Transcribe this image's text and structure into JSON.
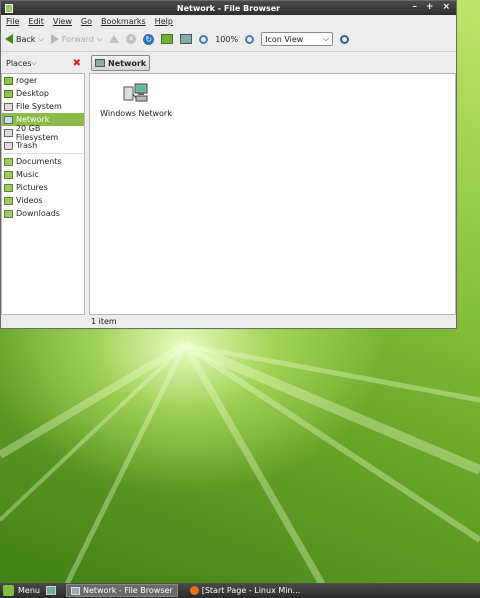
{
  "window": {
    "title": "Network - File Browser",
    "controls": [
      "–",
      "+",
      "×"
    ]
  },
  "menubar": [
    "File",
    "Edit",
    "View",
    "Go",
    "Bookmarks",
    "Help"
  ],
  "toolbar": {
    "back_label": "Back",
    "forward_label": "Forward",
    "zoom_level": "100%",
    "view_mode": "Icon View",
    "view_caret": "⌵"
  },
  "pathbar": {
    "places_label": "Places",
    "current": "Network"
  },
  "sidebar": {
    "items": [
      {
        "label": "roger",
        "icon": "home-folder-icon"
      },
      {
        "label": "Desktop",
        "icon": "desktop-icon"
      },
      {
        "label": "File System",
        "icon": "drive-icon"
      },
      {
        "label": "Network",
        "icon": "network-icon",
        "selected": true
      },
      {
        "label": "20 GB Filesystem",
        "icon": "drive-icon"
      },
      {
        "label": "Trash",
        "icon": "trash-icon"
      },
      {
        "label": "Documents",
        "icon": "folder-icon"
      },
      {
        "label": "Music",
        "icon": "folder-icon"
      },
      {
        "label": "Pictures",
        "icon": "folder-icon"
      },
      {
        "label": "Videos",
        "icon": "folder-icon"
      },
      {
        "label": "Downloads",
        "icon": "folder-icon"
      }
    ]
  },
  "content": {
    "items": [
      {
        "label": "Windows Network",
        "icon": "network-computers-icon"
      }
    ]
  },
  "status": {
    "text": "1 item"
  },
  "panel": {
    "menu_label": "Menu",
    "tasks": [
      {
        "label": "Network - File Browser",
        "active": true
      },
      {
        "label": "[Start Page - Linux Min...",
        "active": false
      }
    ]
  },
  "colors": {
    "accent": "#8dbb4a",
    "desktop": "#8cc63f"
  }
}
